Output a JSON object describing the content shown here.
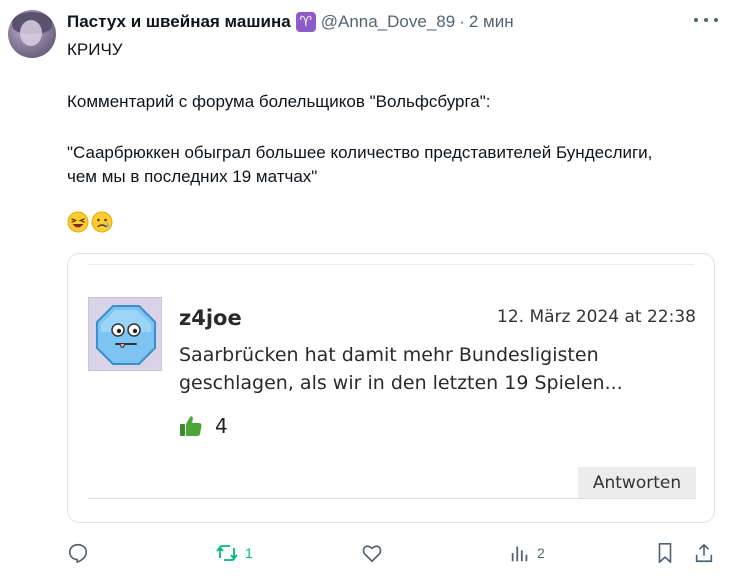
{
  "author": {
    "name": "Пастух и швейная машина",
    "zodiac_icon": "aries-sign-icon",
    "handle": "@Anna_Dove_89",
    "separator": "·",
    "time": "2 мин"
  },
  "tweet": {
    "lines": [
      "КРИЧУ",
      "Комментарий с форума болельщиков \"Вольфсбурга\":",
      "\"Саарбрюккен обыграл большее количество представителей Бундеслиги,",
      "чем мы в последних 19 матчах\""
    ],
    "emojis": [
      "laughing-face-icon",
      "crying-face-icon"
    ]
  },
  "quote": {
    "username": "z4joe",
    "date": "12. März 2024 at 22:38",
    "text_lines": [
      "Saarbrücken hat damit mehr Bundesligisten",
      "geschlagen, als wir in den letzten 19 Spielen..."
    ],
    "likes": "4",
    "reply_label": "Antworten"
  },
  "actions": {
    "reply_count": "",
    "retweet_count": "1",
    "like_count": "",
    "views_count": "2"
  },
  "colors": {
    "text": "#0f1419",
    "secondary": "#536471",
    "retweet_green": "#00ba7c",
    "zodiac_purple": "#8e5cc6",
    "thumb_green": "#3c8a2e"
  }
}
